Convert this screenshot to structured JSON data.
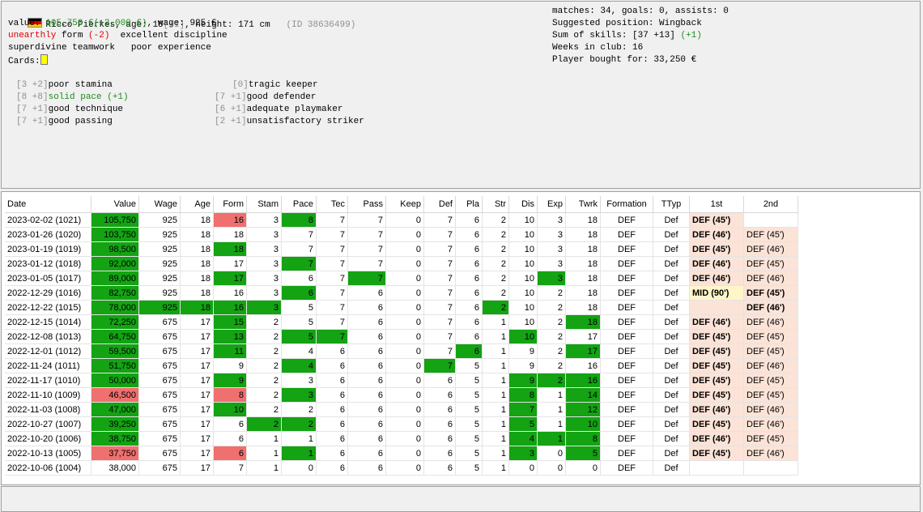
{
  "player": {
    "name": "Ricco Pierkes",
    "age_prefix": ", age: ",
    "age": "18",
    "age_change": "[+1]",
    "height_text": ", height: 171 cm",
    "id_text": "(ID 38636499)",
    "value_label": "value: ",
    "value": "105,750 €",
    "value_change": "(+2,000 €)",
    "wage_text": ", wage: 925 €",
    "form_word": "unearthly",
    "form_label": " form ",
    "form_change": "(-2)",
    "discipline": "excellent discipline",
    "teamwork": "superdivine teamwork",
    "experience": "poor experience",
    "cards_label": "Cards:"
  },
  "stats": {
    "line1": "matches: 34, goals: 0, assists: 0",
    "line2": "Suggested position: Wingback",
    "line3a": "Sum of skills: [37 +13]",
    "line3b": "(+1)",
    "line4": "Weeks in club: 16",
    "line5": "Player bought for: 33,250 €"
  },
  "skills_left": [
    {
      "num": "[3 +2]",
      "text": "poor stamina",
      "extra": ""
    },
    {
      "num": "[8 +8]",
      "text": "solid pace",
      "extra": " (+1)"
    },
    {
      "num": "[7 +1]",
      "text": "good technique",
      "extra": ""
    },
    {
      "num": "[7 +1]",
      "text": "good passing",
      "extra": ""
    }
  ],
  "skills_right": [
    {
      "num": "[0]",
      "text": "tragic keeper"
    },
    {
      "num": "[7 +1]",
      "text": "good defender"
    },
    {
      "num": "[6 +1]",
      "text": "adequate playmaker"
    },
    {
      "num": "[2 +1]",
      "text": "unsatisfactory striker"
    }
  ],
  "colors": {
    "green_highlight": "#13a313",
    "red_highlight": "#f06f6f",
    "position_bg": "#fbe3d7",
    "mid_bg": "#fff6c8"
  },
  "table": {
    "headers": [
      "Date",
      "Value",
      "Wage",
      "Age",
      "Form",
      "Stam",
      "Pace",
      "Tec",
      "Pass",
      "Keep",
      "Def",
      "Pla",
      "Str",
      "Dis",
      "Exp",
      "Twrk",
      "Formation",
      "TTyp",
      "1st",
      "2nd"
    ],
    "rows": [
      [
        "2023-02-02 (1021)",
        "105,750",
        "925",
        "18",
        "16",
        "3",
        "8",
        "7",
        "7",
        "0",
        "7",
        "6",
        "2",
        "10",
        "3",
        "18",
        "DEF",
        "Def",
        "DEF (45')",
        ""
      ],
      [
        "2023-01-26 (1020)",
        "103,750",
        "925",
        "18",
        "18",
        "3",
        "7",
        "7",
        "7",
        "0",
        "7",
        "6",
        "2",
        "10",
        "3",
        "18",
        "DEF",
        "Def",
        "DEF (46')",
        "DEF (45')"
      ],
      [
        "2023-01-19 (1019)",
        "98,500",
        "925",
        "18",
        "18",
        "3",
        "7",
        "7",
        "7",
        "0",
        "7",
        "6",
        "2",
        "10",
        "3",
        "18",
        "DEF",
        "Def",
        "DEF (45')",
        "DEF (46')"
      ],
      [
        "2023-01-12 (1018)",
        "92,000",
        "925",
        "18",
        "17",
        "3",
        "7",
        "7",
        "7",
        "0",
        "7",
        "6",
        "2",
        "10",
        "3",
        "18",
        "DEF",
        "Def",
        "DEF (46')",
        "DEF (45')"
      ],
      [
        "2023-01-05 (1017)",
        "89,000",
        "925",
        "18",
        "17",
        "3",
        "6",
        "7",
        "7",
        "0",
        "7",
        "6",
        "2",
        "10",
        "3",
        "18",
        "DEF",
        "Def",
        "DEF (46')",
        "DEF (46')"
      ],
      [
        "2022-12-29 (1016)",
        "82,750",
        "925",
        "18",
        "16",
        "3",
        "6",
        "7",
        "6",
        "0",
        "7",
        "6",
        "2",
        "10",
        "2",
        "18",
        "DEF",
        "Def",
        "MID (90')",
        "DEF (45')"
      ],
      [
        "2022-12-22 (1015)",
        "78,000",
        "925",
        "18",
        "16",
        "3",
        "5",
        "7",
        "6",
        "0",
        "7",
        "6",
        "2",
        "10",
        "2",
        "18",
        "DEF",
        "Def",
        "",
        "DEF (46')"
      ],
      [
        "2022-12-15 (1014)",
        "72,250",
        "675",
        "17",
        "15",
        "2",
        "5",
        "7",
        "6",
        "0",
        "7",
        "6",
        "1",
        "10",
        "2",
        "18",
        "DEF",
        "Def",
        "DEF (46')",
        "DEF (46')"
      ],
      [
        "2022-12-08 (1013)",
        "64,750",
        "675",
        "17",
        "13",
        "2",
        "5",
        "7",
        "6",
        "0",
        "7",
        "6",
        "1",
        "10",
        "2",
        "17",
        "DEF",
        "Def",
        "DEF (45')",
        "DEF (45')"
      ],
      [
        "2022-12-01 (1012)",
        "59,500",
        "675",
        "17",
        "11",
        "2",
        "4",
        "6",
        "6",
        "0",
        "7",
        "6",
        "1",
        "9",
        "2",
        "17",
        "DEF",
        "Def",
        "DEF (45')",
        "DEF (45')"
      ],
      [
        "2022-11-24 (1011)",
        "51,750",
        "675",
        "17",
        "9",
        "2",
        "4",
        "6",
        "6",
        "0",
        "7",
        "5",
        "1",
        "9",
        "2",
        "16",
        "DEF",
        "Def",
        "DEF (45')",
        "DEF (46')"
      ],
      [
        "2022-11-17 (1010)",
        "50,000",
        "675",
        "17",
        "9",
        "2",
        "3",
        "6",
        "6",
        "0",
        "6",
        "5",
        "1",
        "9",
        "2",
        "16",
        "DEF",
        "Def",
        "DEF (45')",
        "DEF (45')"
      ],
      [
        "2022-11-10 (1009)",
        "46,500",
        "675",
        "17",
        "8",
        "2",
        "3",
        "6",
        "6",
        "0",
        "6",
        "5",
        "1",
        "8",
        "1",
        "14",
        "DEF",
        "Def",
        "DEF (45')",
        "DEF (45')"
      ],
      [
        "2022-11-03 (1008)",
        "47,000",
        "675",
        "17",
        "10",
        "2",
        "2",
        "6",
        "6",
        "0",
        "6",
        "5",
        "1",
        "7",
        "1",
        "12",
        "DEF",
        "Def",
        "DEF (46')",
        "DEF (46')"
      ],
      [
        "2022-10-27 (1007)",
        "39,250",
        "675",
        "17",
        "6",
        "2",
        "2",
        "6",
        "6",
        "0",
        "6",
        "5",
        "1",
        "5",
        "1",
        "10",
        "DEF",
        "Def",
        "DEF (45')",
        "DEF (46')"
      ],
      [
        "2022-10-20 (1006)",
        "38,750",
        "675",
        "17",
        "6",
        "1",
        "1",
        "6",
        "6",
        "0",
        "6",
        "5",
        "1",
        "4",
        "1",
        "8",
        "DEF",
        "Def",
        "DEF (46')",
        "DEF (45')"
      ],
      [
        "2022-10-13 (1005)",
        "37,750",
        "675",
        "17",
        "6",
        "1",
        "1",
        "6",
        "6",
        "0",
        "6",
        "5",
        "1",
        "3",
        "0",
        "5",
        "DEF",
        "Def",
        "DEF (45')",
        "DEF (46')"
      ],
      [
        "2022-10-06 (1004)",
        "38,000",
        "675",
        "17",
        "7",
        "1",
        "0",
        "6",
        "6",
        "0",
        "6",
        "5",
        "1",
        "0",
        "0",
        "0",
        "DEF",
        "Def",
        "",
        ""
      ]
    ],
    "green_cells": [
      [
        0,
        1
      ],
      [
        0,
        6
      ],
      [
        1,
        1
      ],
      [
        2,
        1
      ],
      [
        2,
        4
      ],
      [
        3,
        1
      ],
      [
        3,
        6
      ],
      [
        4,
        1
      ],
      [
        4,
        4
      ],
      [
        4,
        8
      ],
      [
        4,
        14
      ],
      [
        5,
        1
      ],
      [
        5,
        6
      ],
      [
        6,
        1
      ],
      [
        6,
        2
      ],
      [
        6,
        3
      ],
      [
        6,
        4
      ],
      [
        6,
        5
      ],
      [
        6,
        12
      ],
      [
        7,
        1
      ],
      [
        7,
        4
      ],
      [
        7,
        15
      ],
      [
        8,
        1
      ],
      [
        8,
        4
      ],
      [
        8,
        6
      ],
      [
        8,
        7
      ],
      [
        8,
        13
      ],
      [
        9,
        1
      ],
      [
        9,
        4
      ],
      [
        9,
        11
      ],
      [
        9,
        15
      ],
      [
        10,
        1
      ],
      [
        10,
        6
      ],
      [
        10,
        10
      ],
      [
        11,
        1
      ],
      [
        11,
        4
      ],
      [
        11,
        13
      ],
      [
        11,
        14
      ],
      [
        11,
        15
      ],
      [
        12,
        6
      ],
      [
        12,
        13
      ],
      [
        12,
        15
      ],
      [
        13,
        1
      ],
      [
        13,
        4
      ],
      [
        13,
        13
      ],
      [
        13,
        15
      ],
      [
        14,
        1
      ],
      [
        14,
        5
      ],
      [
        14,
        6
      ],
      [
        14,
        13
      ],
      [
        14,
        15
      ],
      [
        15,
        1
      ],
      [
        15,
        13
      ],
      [
        15,
        14
      ],
      [
        15,
        15
      ],
      [
        16,
        6
      ],
      [
        16,
        13
      ],
      [
        16,
        15
      ]
    ],
    "red_cells": [
      [
        0,
        4
      ],
      [
        12,
        1
      ],
      [
        12,
        4
      ],
      [
        16,
        1
      ],
      [
        16,
        4
      ]
    ],
    "bold_2nd": [
      5,
      6
    ]
  }
}
